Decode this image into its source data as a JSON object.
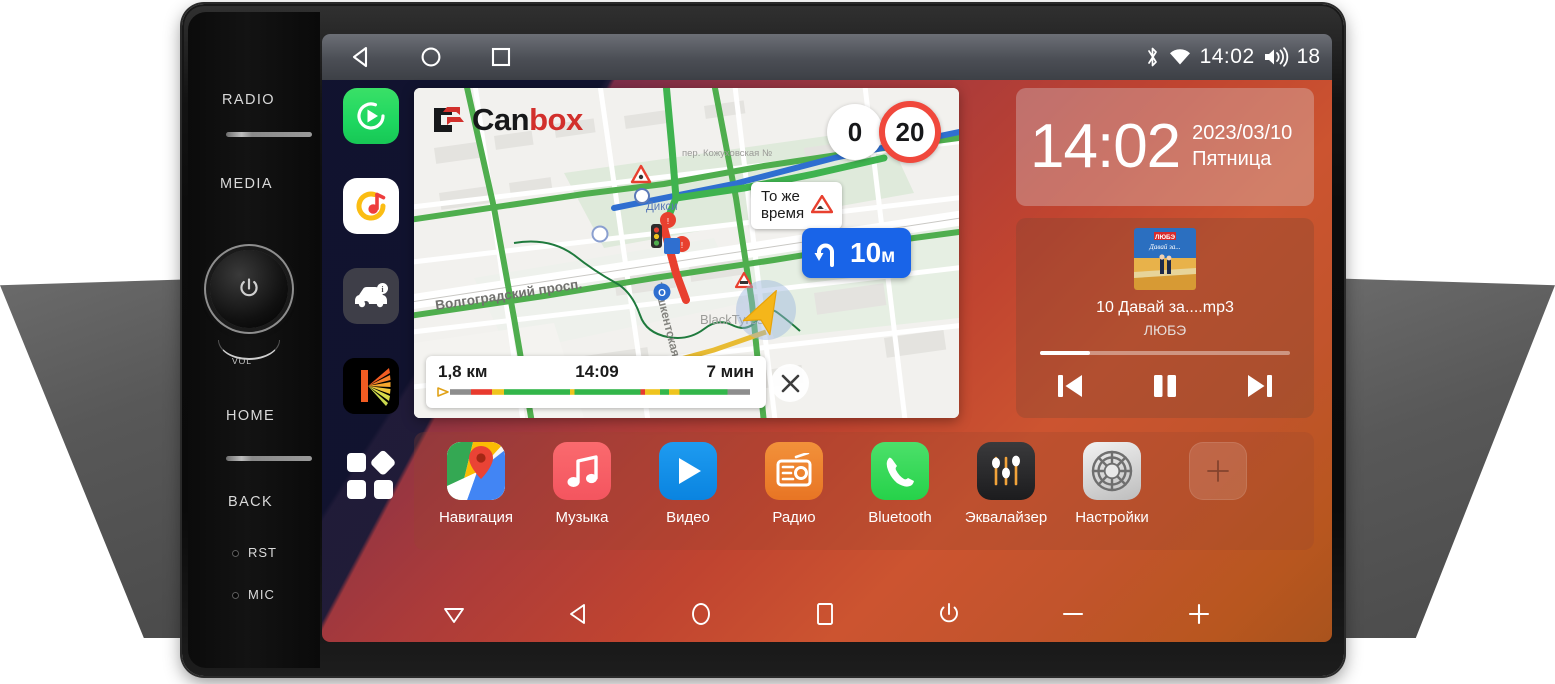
{
  "device": {
    "bezel": {
      "radio_label": "RADIO",
      "media_label": "MEDIA",
      "home_label": "HOME",
      "back_label": "BACK",
      "vol_label": "VOL",
      "rst_label": "RST",
      "mic_label": "MIC"
    }
  },
  "statusbar": {
    "bluetooth_icon": "bluetooth-icon",
    "wifi_icon": "wifi-icon",
    "clock": "14:02",
    "volume_icon": "speaker-icon",
    "volume_value": "18",
    "nav_back_icon": "back-triangle-icon",
    "nav_home_icon": "home-circle-icon",
    "nav_recents_icon": "recents-square-icon"
  },
  "rail": {
    "items": [
      {
        "name": "carplay",
        "icon": "play-circle-icon"
      },
      {
        "name": "yandex-music",
        "icon": "music-note-circle-icon"
      },
      {
        "name": "car-info",
        "icon": "car-icon"
      },
      {
        "name": "kaspersky",
        "icon": "k-rays-icon"
      },
      {
        "name": "app-drawer",
        "icon": "grid-squares-icon"
      }
    ]
  },
  "map": {
    "watermark": {
      "part1": "Can",
      "part2": "box"
    },
    "speed_current": "0",
    "speed_limit": "20",
    "tooltip": {
      "text": "То же\nвремя",
      "line1": "То же",
      "line2": "время",
      "icon": "road-warning-icon"
    },
    "maneuver": {
      "icon": "u-turn-left-icon",
      "distance": "10",
      "unit": "м",
      "label": "10 м"
    },
    "route": {
      "distance": "1,8 км",
      "eta": "14:09",
      "duration": "7 мин",
      "close_icon": "close-x-icon",
      "traffic_segments": [
        {
          "color": "#8d8d8d",
          "width": 7
        },
        {
          "color": "#e83a2e",
          "width": 7
        },
        {
          "color": "#efc41e",
          "width": 4
        },
        {
          "color": "#33b64a",
          "width": 22
        },
        {
          "color": "#efc41e",
          "width": 1.5
        },
        {
          "color": "#33b64a",
          "width": 22
        },
        {
          "color": "#e83a2e",
          "width": 1.5
        },
        {
          "color": "#efc41e",
          "width": 5
        },
        {
          "color": "#33b64a",
          "width": 3
        },
        {
          "color": "#efc41e",
          "width": 3.5
        },
        {
          "color": "#33b64a",
          "width": 16
        },
        {
          "color": "#8d8d8d",
          "width": 7.5
        }
      ]
    },
    "labels": {
      "street_main": "Волгоградский просп.",
      "street_side": "Ташкентская ул.",
      "poi_shop": "Дикси",
      "poi_tyres": "BlackTyres"
    },
    "colors": {
      "route_line": "#3fb34f",
      "traffic_heavy": "#e83a2e",
      "traffic_medium": "#efc41e",
      "traffic_free": "#33b64a",
      "water_road": "#2f6fd0",
      "park": "#d9ead3",
      "position_arrow": "#f5b61a"
    }
  },
  "widgets": {
    "clock": {
      "time": "14:02",
      "date": "2023/03/10",
      "weekday": "Пятница"
    },
    "music": {
      "track": "10 Давай за....mp3",
      "artist": "ЛЮБЭ",
      "album_art": "lyube-album-cover",
      "album_art_title": "ЛЮБЭ",
      "progress_percent": 20,
      "prev_icon": "skip-previous-icon",
      "play_pause_icon": "pause-icon",
      "next_icon": "skip-next-icon"
    }
  },
  "dock": {
    "items": [
      {
        "label": "Навигация",
        "icon": "maps-pin-icon"
      },
      {
        "label": "Музыка",
        "icon": "music-note-icon"
      },
      {
        "label": "Видео",
        "icon": "play-triangle-icon"
      },
      {
        "label": "Радио",
        "icon": "radio-icon"
      },
      {
        "label": "Bluetooth",
        "icon": "phone-handset-icon"
      },
      {
        "label": "Эквалайзер",
        "icon": "sliders-icon"
      },
      {
        "label": "Настройки",
        "icon": "gear-icon"
      },
      {
        "label": "",
        "icon": "plus-add-icon"
      }
    ]
  },
  "sysnav": {
    "items": [
      {
        "name": "dropdown",
        "icon": "triangle-down-icon"
      },
      {
        "name": "back",
        "icon": "triangle-left-icon"
      },
      {
        "name": "home",
        "icon": "circle-icon"
      },
      {
        "name": "recents",
        "icon": "square-icon"
      },
      {
        "name": "power",
        "icon": "power-icon"
      },
      {
        "name": "volume-down",
        "icon": "minus-icon"
      },
      {
        "name": "volume-up",
        "icon": "plus-icon"
      }
    ]
  },
  "theme": {
    "accent_orange": "#c2542c",
    "accent_purple": "#5a2352",
    "dark_navy": "#10122e",
    "status_bar": "#4b4e55"
  }
}
